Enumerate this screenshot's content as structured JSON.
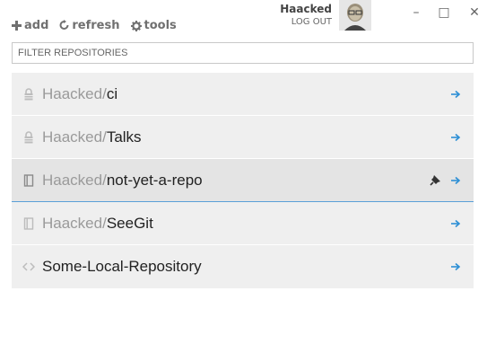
{
  "toolbar": {
    "add_label": "add",
    "refresh_label": "refresh",
    "tools_label": "tools"
  },
  "user": {
    "name": "Haacked",
    "logout_label": "LOG OUT"
  },
  "window_controls": {
    "minimize": "–",
    "maximize": "□",
    "close": "✕"
  },
  "filter": {
    "placeholder": "FILTER REPOSITORIES",
    "value": ""
  },
  "repositories": [
    {
      "owner": "Haacked/",
      "name": "ci",
      "icon": "lock-icon",
      "selected": false
    },
    {
      "owner": "Haacked/",
      "name": "Talks",
      "icon": "lock-icon",
      "selected": false
    },
    {
      "owner": "Haacked/",
      "name": "not-yet-a-repo",
      "icon": "book-icon",
      "selected": true
    },
    {
      "owner": "Haacked/",
      "name": "SeeGit",
      "icon": "book-icon",
      "selected": false
    },
    {
      "owner": "",
      "name": "Some-Local-Repository",
      "icon": "code-icon",
      "selected": false
    }
  ],
  "colors": {
    "accent": "#2d8fd5",
    "row_background": "#efefef",
    "selected_row_background": "#e4e4e4",
    "owner_text": "#9a9a9a"
  }
}
